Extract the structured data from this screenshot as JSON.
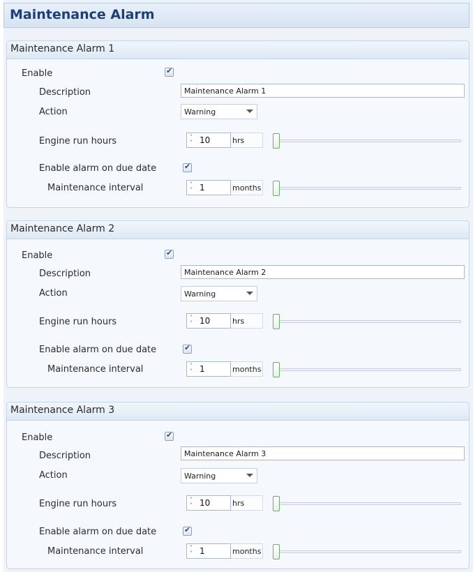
{
  "page": {
    "title": "Maintenance Alarm"
  },
  "labels": {
    "enable": "Enable",
    "description": "Description",
    "action": "Action",
    "engine_run_hours": "Engine run hours",
    "enable_due_date": "Enable alarm on due date",
    "maintenance_interval": "Maintenance interval"
  },
  "alarms": [
    {
      "title": "Maintenance Alarm 1",
      "enabled": true,
      "description": "Maintenance Alarm 1",
      "action": "Warning",
      "engine_run_hours": {
        "value": "10",
        "unit": "hrs",
        "slider_level": 0
      },
      "due_date_enabled": true,
      "maintenance_interval": {
        "value": "1",
        "unit": "months",
        "slider_level": 0
      }
    },
    {
      "title": "Maintenance Alarm 2",
      "enabled": true,
      "description": "Maintenance Alarm 2",
      "action": "Warning",
      "engine_run_hours": {
        "value": "10",
        "unit": "hrs",
        "slider_level": 0
      },
      "due_date_enabled": true,
      "maintenance_interval": {
        "value": "1",
        "unit": "months",
        "slider_level": 0
      }
    },
    {
      "title": "Maintenance Alarm 3",
      "enabled": true,
      "description": "Maintenance Alarm 3",
      "action": "Warning",
      "engine_run_hours": {
        "value": "10",
        "unit": "hrs",
        "slider_level": 0
      },
      "due_date_enabled": true,
      "maintenance_interval": {
        "value": "1",
        "unit": "months",
        "slider_level": 0
      }
    }
  ]
}
